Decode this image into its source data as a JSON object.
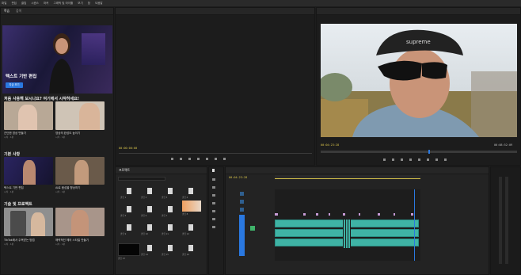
{
  "menubar": {
    "items": [
      "파일",
      "편집",
      "클립",
      "시퀀스",
      "마커",
      "그래픽 및 타이틀",
      "보기",
      "창",
      "도움말"
    ]
  },
  "learn": {
    "tabs": [
      "학습",
      "검색"
    ],
    "hero": {
      "title": "텍스트 기반 편집",
      "button": "지금 보기"
    },
    "section_start": "처음 사용해 보시나요? 여기에서 시작하세요!",
    "start_items": [
      {
        "title": "간단한 영상 만들기",
        "sub": "시작 · 1분"
      },
      {
        "title": "영상의 완성도 높이기",
        "sub": "시작 · 1분"
      }
    ],
    "section_basic": "기본 사항",
    "basic_items": [
      {
        "title": "텍스트 기반 편집",
        "sub": "시작 · 1분"
      },
      {
        "title": "AI로 음성을 향상하기",
        "sub": "시작 · 1분"
      }
    ],
    "section_tech": "기술 및 프로젝트",
    "tech_items": [
      {
        "title": "TikTok에서 주목받는 방법",
        "sub": "시작 · 1분"
      },
      {
        "title": "매력적인 헤어 스타일 만들기",
        "sub": "시작 · 1분"
      }
    ]
  },
  "source": {
    "timecode": "00:00:00:00"
  },
  "program": {
    "timecode_left": "00:04:23:28",
    "timecode_right": "00:08:52:09",
    "overlay_text": "supreme"
  },
  "project": {
    "title": "프로젝트",
    "items": [
      "클립 1",
      "클립 2",
      "클립 3",
      "클립 4",
      "클립 5",
      "클립 6",
      "클립 7",
      "클립 8",
      "클립 9",
      "클립 10",
      "클립 11",
      "클립 12",
      "클립 13",
      "클립 14",
      "클립 15",
      "클립 16"
    ]
  },
  "timeline": {
    "timecode": "00:04:23:28"
  },
  "colors": {
    "accent": "#2a78e0",
    "clip_teal": "#3fb3a5",
    "clip_pink": "#c79bd6",
    "timecode": "#d7c34a"
  }
}
